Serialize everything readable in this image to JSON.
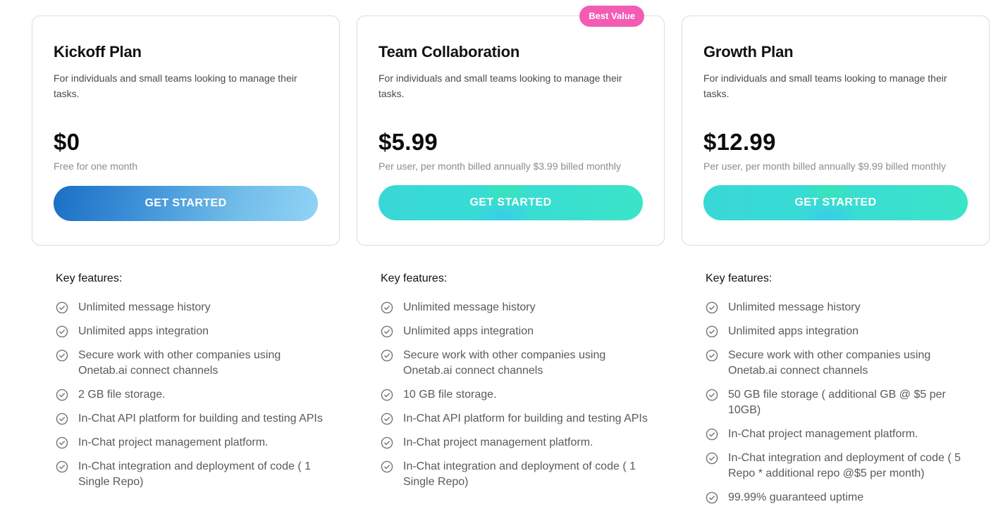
{
  "plans": [
    {
      "title": "Kickoff Plan",
      "description": "For individuals and small teams looking to manage their tasks.",
      "price": "$0",
      "price_note": "Free for one month",
      "cta_label": "GET STARTED",
      "badge": null,
      "features_title": "Key features:",
      "features": [
        "Unlimited message history",
        "Unlimited apps integration",
        "Secure work with other companies using Onetab.ai connect channels",
        "2 GB file storage.",
        "In-Chat API platform for building and testing APIs",
        "In-Chat project management platform.",
        "In-Chat integration and deployment of code ( 1 Single Repo)"
      ]
    },
    {
      "title": "Team Collaboration",
      "description": "For individuals and small teams looking to manage their tasks.",
      "price": "$5.99",
      "price_note": "Per user, per month billed annually $3.99 billed monthly",
      "cta_label": "GET STARTED",
      "badge": "Best Value",
      "features_title": "Key features:",
      "features": [
        "Unlimited message history",
        "Unlimited apps integration",
        "Secure work with other companies using Onetab.ai connect channels",
        "10 GB file storage.",
        "In-Chat API platform for building and testing APIs",
        "In-Chat project management platform.",
        "In-Chat integration and deployment of code ( 1 Single Repo)"
      ]
    },
    {
      "title": "Growth Plan",
      "description": "For individuals and small teams looking to manage their tasks.",
      "price": "$12.99",
      "price_note": "Per user, per month billed annually $9.99 billed monthly",
      "cta_label": "GET STARTED",
      "badge": null,
      "features_title": "Key features:",
      "features": [
        "Unlimited message history",
        "Unlimited apps integration",
        "Secure work with other companies using Onetab.ai connect channels",
        "50 GB file storage ( additional GB @ $5 per 10GB)",
        "In-Chat project management platform.",
        "In-Chat integration and deployment of code ( 5 Repo * additional repo @$5 per month)",
        "99.99% guaranteed uptime"
      ]
    }
  ],
  "icons": {
    "feature_bullet": "check-circle-icon"
  },
  "colors": {
    "badge": "#f25cb4",
    "kickoff_cta_start": "#1a6fc4",
    "kickoff_cta_end": "#92d3f6",
    "teal_cta": "#38d8d6",
    "teal_cta_accent": "#36e8aa",
    "icon_gray": "#777777"
  }
}
